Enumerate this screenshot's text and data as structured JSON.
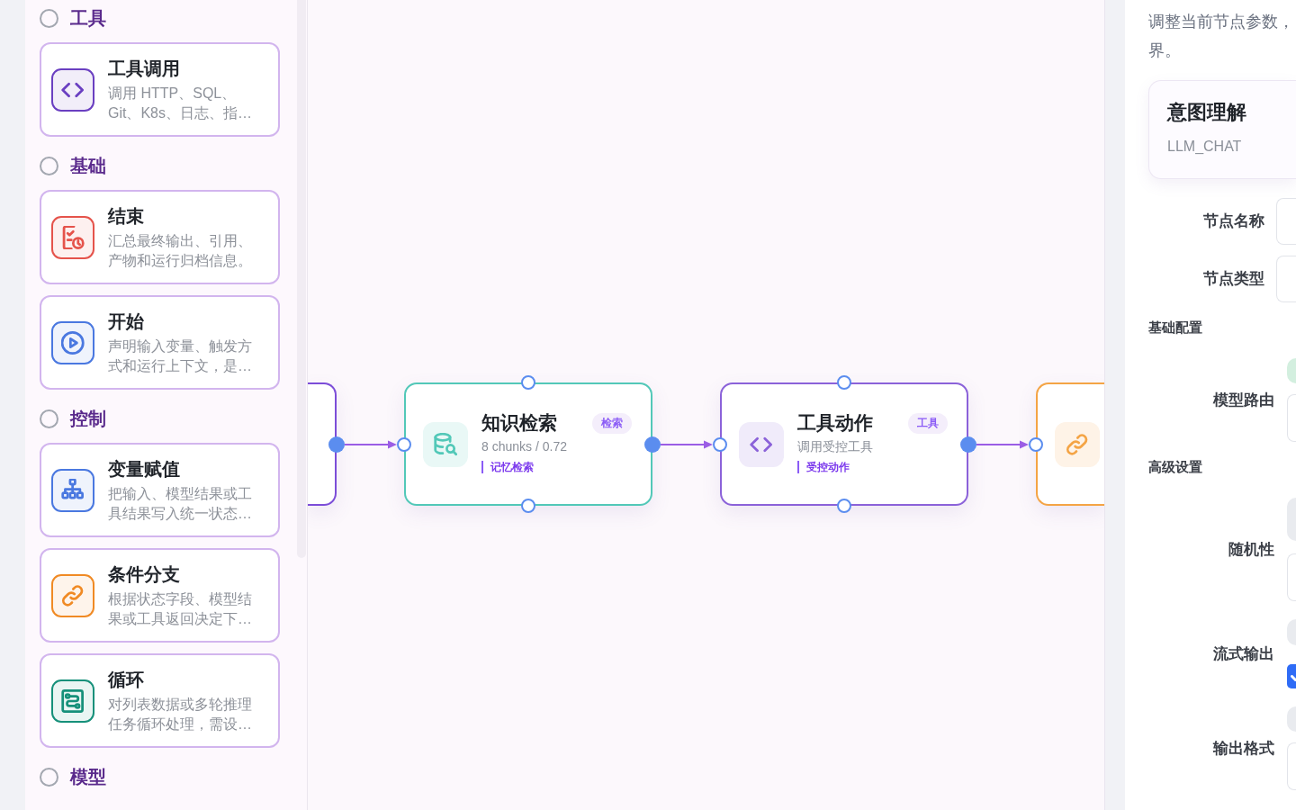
{
  "sidebar": {
    "groups": [
      {
        "title": "工具",
        "items": [
          {
            "kind": "tool",
            "color": "#6a3fc1",
            "title": "工具调用",
            "description": "调用 HTTP、SQL、Git、K8s、日志、指…"
          }
        ]
      },
      {
        "title": "基础",
        "items": [
          {
            "kind": "end",
            "color": "#e5534b",
            "title": "结束",
            "description": "汇总最终输出、引用、产物和运行归档信息。"
          },
          {
            "kind": "start",
            "color": "#4a78e0",
            "title": "开始",
            "description": "声明输入变量、触发方式和运行上下文，是…"
          }
        ]
      },
      {
        "title": "控制",
        "items": [
          {
            "kind": "assign",
            "color": "#4a78e0",
            "title": "变量赋值",
            "description": "把输入、模型结果或工具结果写入统一状态…"
          },
          {
            "kind": "branch",
            "color": "#f08a24",
            "title": "条件分支",
            "description": "根据状态字段、模型结果或工具返回决定下…"
          },
          {
            "kind": "loop",
            "color": "#16907a",
            "title": "循环",
            "description": "对列表数据或多轮推理任务循环处理，需设…"
          }
        ]
      },
      {
        "title": "模型"
      }
    ]
  },
  "canvas": {
    "nodes": [
      {
        "color": "#7c4dd8"
      },
      {
        "kind": "retrieval",
        "color": "#52c8b8",
        "title": "知识检索",
        "badge": "检索",
        "subtitle": "8 chunks / 0.72",
        "tag": "记忆检索"
      },
      {
        "kind": "tool",
        "color": "#8b62d9",
        "title": "工具动作",
        "badge": "工具",
        "subtitle": "调用受控工具",
        "tag": "受控动作"
      },
      {
        "kind": "branch",
        "color": "#f4a445"
      }
    ]
  },
  "inspector": {
    "description_lines": [
      "调整当前节点参数，",
      "界。"
    ],
    "node_card": {
      "title": "意图理解",
      "subtitle": "LLM_CHAT"
    },
    "basic_fields": [
      {
        "label": "节点名称",
        "kind": "text"
      },
      {
        "label": "节点类型",
        "kind": "text"
      }
    ],
    "sections": [
      {
        "title": "基础配置",
        "fields": [
          {
            "label": "模型路由",
            "kind": "select",
            "color": "#d3efdf"
          }
        ]
      },
      {
        "title": "高级设置",
        "fields": [
          {
            "label": "随机性",
            "kind": "number",
            "color": "#e9ebef"
          },
          {
            "label": "流式输出",
            "kind": "checkbox",
            "color": "#e9ebef",
            "checked": true
          },
          {
            "label": "输出格式",
            "kind": "select",
            "color": "#e9ebef"
          }
        ]
      }
    ]
  }
}
